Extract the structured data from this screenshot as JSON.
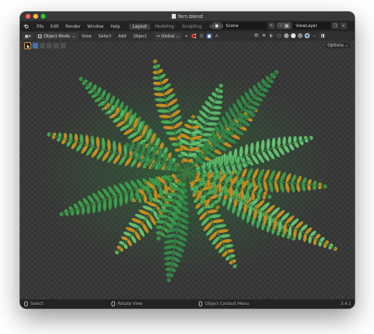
{
  "window": {
    "title": "fern.blend"
  },
  "menubar": {
    "items": [
      "File",
      "Edit",
      "Render",
      "Window",
      "Help"
    ],
    "workspaces": [
      "Layout",
      "Modeling",
      "Sculpting",
      "UV Editing"
    ],
    "scene": "Scene",
    "view_layer": "ViewLayer"
  },
  "header": {
    "mode": "Object Mode",
    "menus": [
      "View",
      "Select",
      "Add",
      "Object"
    ],
    "transform_orientation": "Global"
  },
  "viewport": {
    "options_label": "Options"
  },
  "status": {
    "select": "Select",
    "rotate": "Rotate View",
    "context_menu": "Object Context Menu",
    "version": "3.4.1"
  },
  "colors": {
    "accent": "#4772b3",
    "active_tool": "#e8a23b",
    "fern_green": "#3f9a4c",
    "fern_orange": "#c98a1e"
  }
}
